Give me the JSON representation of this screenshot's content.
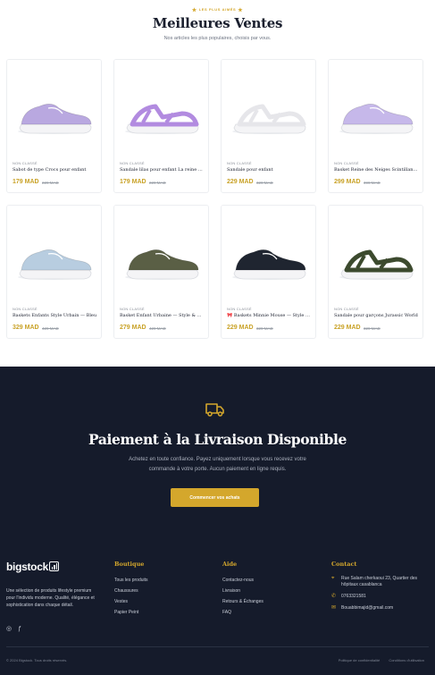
{
  "best_sellers": {
    "eyebrow": "LES PLUS AIMÉS",
    "title": "Meilleures Ventes",
    "subtitle": "Nos articles les plus populaires, choisis par vous."
  },
  "products": [
    {
      "category": "NON CLASSÉ",
      "name": "Sabot de type Crocs pour enfant",
      "price": "179 MAD",
      "old_price": "229 MAD",
      "image": "lilac-clog",
      "color": "#b9a8e0"
    },
    {
      "category": "NON CLASSÉ",
      "name": "Sandale lilas pour enfant La reine des neiges",
      "price": "179 MAD",
      "old_price": "229 MAD",
      "image": "lilac-sandal",
      "color": "#b28be0"
    },
    {
      "category": "NON CLASSÉ",
      "name": "Sandale pour enfant",
      "price": "229 MAD",
      "old_price": "329 MAD",
      "image": "white-sandal",
      "color": "#e6e6ea"
    },
    {
      "category": "NON CLASSÉ",
      "name": "Basket Reine des Neiges Scintillantes",
      "price": "299 MAD",
      "old_price": "499 MAD",
      "image": "frozen-sneaker",
      "color": "#c6b8ea"
    },
    {
      "category": "NON CLASSÉ",
      "name": "Baskets Enfants Style Urbain — Bleu",
      "price": "329 MAD",
      "old_price": "429 MAD",
      "image": "blue-sneaker",
      "color": "#b8cde0"
    },
    {
      "category": "NON CLASSÉ",
      "name": "Basket Enfant Urbaine — Style & Confort",
      "price": "279 MAD",
      "old_price": "429 MAD",
      "image": "olive-sneaker",
      "color": "#5a5f45"
    },
    {
      "category": "NON CLASSÉ",
      "name": "🎀 Baskets Minnie Mouse — Style Magique",
      "price": "229 MAD",
      "old_price": "329 MAD",
      "image": "minnie-sneaker",
      "color": "#1f2530"
    },
    {
      "category": "NON CLASSÉ",
      "name": "Sandale pour garçons Jurassic World",
      "price": "229 MAD",
      "old_price": "329 MAD",
      "image": "dino-sandal",
      "color": "#3c4a2e"
    }
  ],
  "cod": {
    "icon": "truck-icon",
    "title": "Paiement à la Livraison Disponible",
    "line1": "Achetez en toute confiance. Payez uniquement lorsque vous recevez votre",
    "line2": "commande à votre porte. Aucun paiement en ligne requis.",
    "cta": "Commencer vos achats"
  },
  "footer": {
    "logo": "bigstock",
    "about": "Une sélection de produits lifestyle premium pour l'individu moderne. Qualité, élégance et sophistication dans chaque détail.",
    "social": [
      "instagram-icon",
      "facebook-icon"
    ],
    "boutique": {
      "title": "Boutique",
      "items": [
        "Tous les produits",
        "Chaussures",
        "Vestes",
        "Papier Peint"
      ]
    },
    "aide": {
      "title": "Aide",
      "items": [
        "Contactez-nous",
        "Livraison",
        "Retours & Échanges",
        "FAQ"
      ]
    },
    "contact": {
      "title": "Contact",
      "address": "Rue Salam cherkaoui 23, Quartier des hôpitaux casablanca",
      "phone": "0763321581",
      "email": "Bouabbimajid@gmail.com"
    },
    "copyright": "© 2024 Bigstock. Tous droits réservés.",
    "legal": [
      "Politique de confidentialité",
      "Conditions d'utilisation"
    ]
  },
  "accent_color": "#d4a72c",
  "dark_bg": "#151b2b"
}
